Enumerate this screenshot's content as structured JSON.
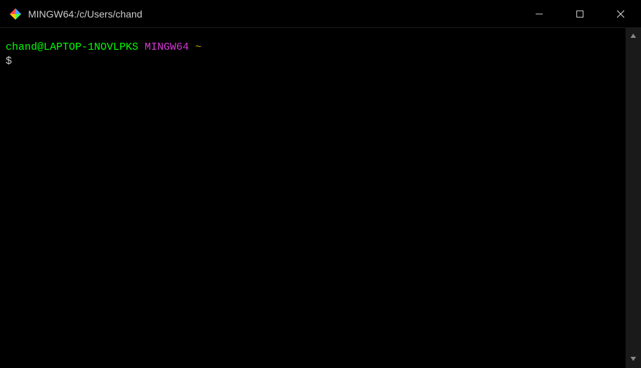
{
  "titlebar": {
    "title": "MINGW64:/c/Users/chand"
  },
  "terminal": {
    "user_host": "chand@LAPTOP-1NOVLPKS",
    "env": "MINGW64",
    "path": "~",
    "prompt_symbol": "$"
  }
}
